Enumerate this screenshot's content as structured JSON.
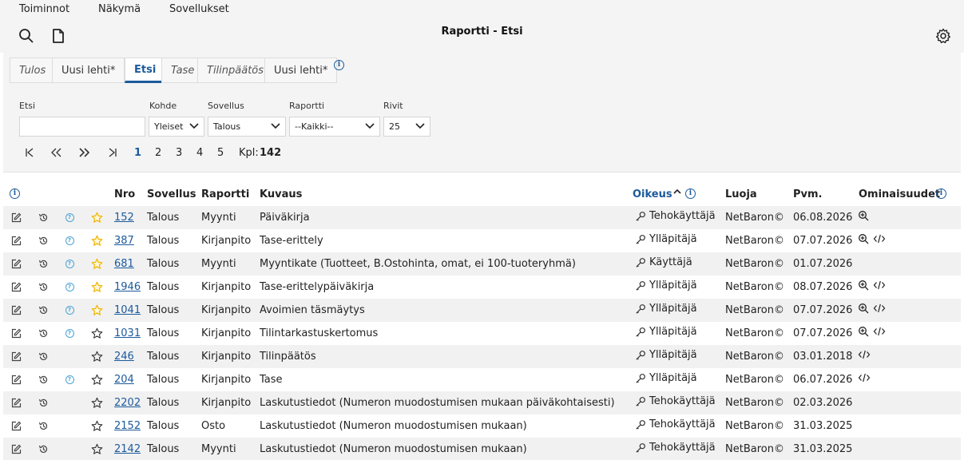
{
  "menu": [
    "Toiminnot",
    "Näkymä",
    "Sovellukset"
  ],
  "title": "Raportti - Etsi",
  "tabs": [
    {
      "label": "Tulos",
      "italic": true
    },
    {
      "label": "Uusi lehti*",
      "italic": false
    },
    {
      "label": "Etsi",
      "italic": false,
      "active": true
    },
    {
      "label": "Tase",
      "italic": true
    },
    {
      "label": "Tilinpäätös",
      "italic": true
    },
    {
      "label": "Uusi lehti*",
      "italic": false
    }
  ],
  "filters": {
    "etsi_label": "Etsi",
    "etsi_value": "",
    "kohde_label": "Kohde",
    "kohde_value": "Yleiset",
    "sovellus_label": "Sovellus",
    "sovellus_value": "Talous",
    "raportti_label": "Raportti",
    "raportti_value": "--Kaikki--",
    "rivit_label": "Rivit",
    "rivit_value": "25"
  },
  "pager": {
    "pages": [
      "1",
      "2",
      "3",
      "4",
      "5"
    ],
    "current": "1",
    "count_label": "Kpl:",
    "count": "142"
  },
  "columns": {
    "nro": "Nro",
    "sovellus": "Sovellus",
    "raportti": "Raportti",
    "kuvaus": "Kuvaus",
    "oikeus": "Oikeus",
    "luoja": "Luoja",
    "pvm": "Pvm.",
    "ominaisuudet": "Ominaisuudet"
  },
  "rows": [
    {
      "nro": "152",
      "sovellus": "Talous",
      "raportti": "Myynti",
      "kuvaus": "Päiväkirja",
      "oikeus": "Tehokäyttäjä",
      "luoja": "NetBaron©",
      "pvm": "06.08.2026",
      "help": true,
      "star": "filled",
      "features": [
        "zoom-icon"
      ]
    },
    {
      "nro": "387",
      "sovellus": "Talous",
      "raportti": "Kirjanpito",
      "kuvaus": "Tase-erittely",
      "oikeus": "Ylläpitäjä",
      "luoja": "NetBaron©",
      "pvm": "07.07.2026",
      "help": true,
      "star": "filled",
      "features": [
        "zoom-icon",
        "code-icon"
      ]
    },
    {
      "nro": "681",
      "sovellus": "Talous",
      "raportti": "Myynti",
      "kuvaus": "Myyntikate (Tuotteet, B.Ostohinta, omat, ei 100-tuoteryhmä)",
      "oikeus": "Käyttäjä",
      "luoja": "NetBaron©",
      "pvm": "01.07.2026",
      "help": true,
      "star": "filled",
      "features": []
    },
    {
      "nro": "1946",
      "sovellus": "Talous",
      "raportti": "Kirjanpito",
      "kuvaus": "Tase-erittelypäiväkirja",
      "oikeus": "Ylläpitäjä",
      "luoja": "NetBaron©",
      "pvm": "08.07.2026",
      "help": true,
      "star": "filled",
      "features": [
        "zoom-icon",
        "code-icon"
      ]
    },
    {
      "nro": "1041",
      "sovellus": "Talous",
      "raportti": "Kirjanpito",
      "kuvaus": "Avoimien täsmäytys",
      "oikeus": "Ylläpitäjä",
      "luoja": "NetBaron©",
      "pvm": "07.07.2026",
      "help": true,
      "star": "filled",
      "features": [
        "zoom-icon",
        "code-icon"
      ]
    },
    {
      "nro": "1031",
      "sovellus": "Talous",
      "raportti": "Kirjanpito",
      "kuvaus": "Tilintarkastuskertomus",
      "oikeus": "Ylläpitäjä",
      "luoja": "NetBaron©",
      "pvm": "07.07.2026",
      "help": true,
      "star": "empty",
      "features": [
        "zoom-icon",
        "code-icon"
      ]
    },
    {
      "nro": "246",
      "sovellus": "Talous",
      "raportti": "Kirjanpito",
      "kuvaus": "Tilinpäätös",
      "oikeus": "Ylläpitäjä",
      "luoja": "NetBaron©",
      "pvm": "03.01.2018",
      "help": false,
      "star": "empty",
      "features": [
        "code-icon"
      ]
    },
    {
      "nro": "204",
      "sovellus": "Talous",
      "raportti": "Kirjanpito",
      "kuvaus": "Tase",
      "oikeus": "Ylläpitäjä",
      "luoja": "NetBaron©",
      "pvm": "06.07.2026",
      "help": true,
      "star": "empty",
      "features": [
        "code-icon"
      ]
    },
    {
      "nro": "2202",
      "sovellus": "Talous",
      "raportti": "Kirjanpito",
      "kuvaus": "Laskutustiedot (Numeron muodostumisen mukaan päiväkohtaisesti)",
      "oikeus": "Tehokäyttäjä",
      "luoja": "NetBaron©",
      "pvm": "02.03.2026",
      "help": false,
      "star": "empty",
      "features": []
    },
    {
      "nro": "2152",
      "sovellus": "Talous",
      "raportti": "Osto",
      "kuvaus": "Laskutustiedot (Numeron muodostumisen mukaan)",
      "oikeus": "Tehokäyttäjä",
      "luoja": "NetBaron©",
      "pvm": "31.03.2025",
      "help": false,
      "star": "empty",
      "features": []
    },
    {
      "nro": "2142",
      "sovellus": "Talous",
      "raportti": "Myynti",
      "kuvaus": "Laskutustiedot (Numeron muodostumisen mukaan)",
      "oikeus": "Tehokäyttäjä",
      "luoja": "NetBaron©",
      "pvm": "31.03.2025",
      "help": false,
      "star": "empty",
      "features": []
    }
  ],
  "colors": {
    "accent": "#1c5a9c",
    "star": "#f0b400",
    "help": "#4aa3d6"
  }
}
